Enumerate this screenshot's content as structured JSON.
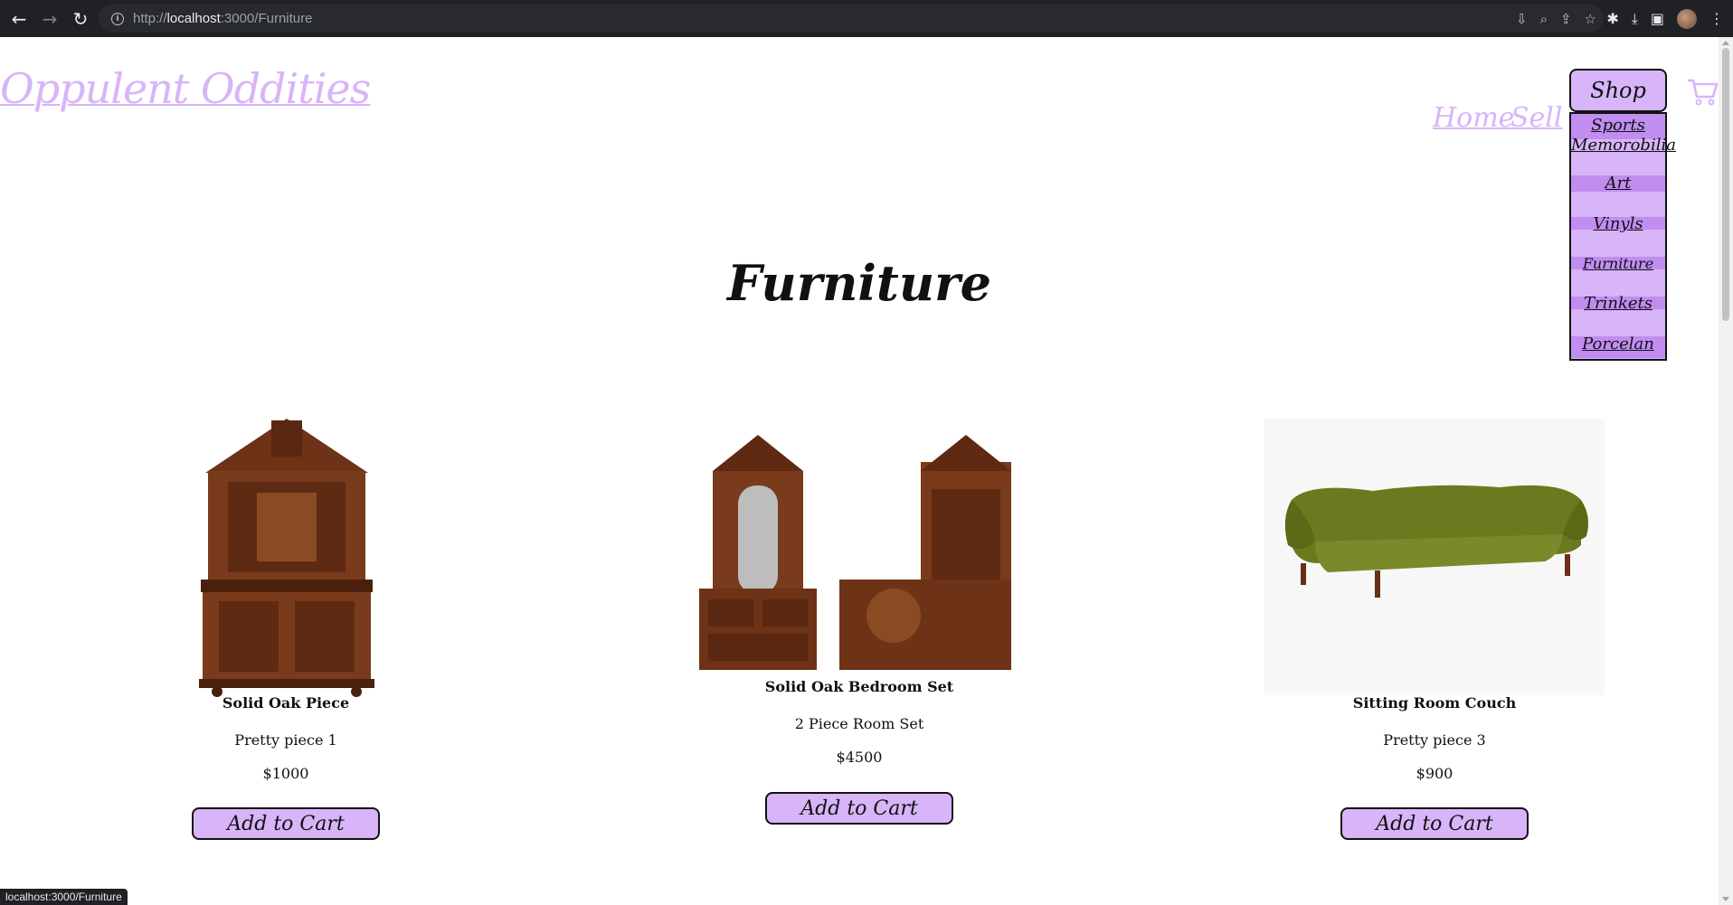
{
  "browser": {
    "url_prefix": "http://",
    "url_host": "localhost",
    "url_rest": ":3000/Furniture",
    "status_text": "localhost:3000/Furniture"
  },
  "header": {
    "brand": "Oppulent Oddities",
    "nav_home": "Home",
    "nav_sell": "Sell",
    "shop_label": "Shop"
  },
  "shop_menu": {
    "items": [
      "Sports Memorobilia",
      "Art",
      "Vinyls",
      "Furniture",
      "Trinkets",
      "Porcelan"
    ]
  },
  "main": {
    "title": "Furniture",
    "products": [
      {
        "name": "Solid Oak Piece",
        "description": "Pretty piece 1",
        "price": "$1000",
        "button": "Add to Cart"
      },
      {
        "name": "Solid Oak Bedroom Set",
        "description": "2 Piece Room Set",
        "price": "$4500",
        "button": "Add to Cart"
      },
      {
        "name": "Sitting Room Couch",
        "description": "Pretty piece 3",
        "price": "$900",
        "button": "Add to Cart"
      }
    ]
  },
  "colors": {
    "accent": "#d8b4f8",
    "accent_dark": "#c18df1",
    "chrome": "#202124"
  }
}
